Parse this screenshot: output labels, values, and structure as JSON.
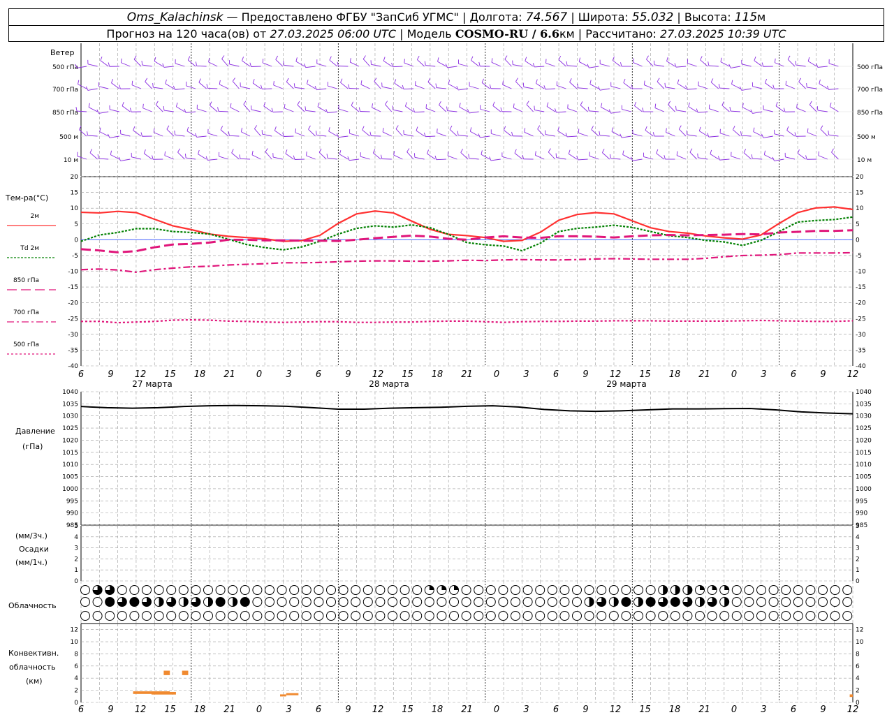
{
  "header": {
    "line1": {
      "station": "Oms_Kalachinsk",
      "provider": " — Предоставлено ФГБУ \"ЗапСиб УГМС\" | Долгота: ",
      "lon": "74.567",
      "lat_label": " | Широта: ",
      "lat": "55.032",
      "alt_label": " | Высота: ",
      "alt": "115",
      "alt_unit": "м"
    },
    "line2": {
      "forecast_label": "Прогноз на 120 часа(ов) от ",
      "forecast_start": "27.03.2025 06:00 UTC",
      "model_label": " | Модель ",
      "model": "COSMO-RU / 6.6",
      "model_unit": "км",
      "calc_label": " | Рассчитано: ",
      "calc_time": "27.03.2025 10:39 UTC"
    }
  },
  "panels": {
    "wind": {
      "title": "Ветер",
      "levels": [
        "500 гПа",
        "700 гПа",
        "850 гПа",
        "500 м",
        "10  м"
      ]
    },
    "temp": {
      "title": "Тем-ра(°C)",
      "legend": [
        {
          "label": "2м",
          "color": "#ff3030",
          "dash": ""
        },
        {
          "label": "Td  2м",
          "color": "#008000",
          "dash": "3,2"
        },
        {
          "label": "850 гПа",
          "color": "#e0157a",
          "dash": "14,6"
        },
        {
          "label": "700 гПа",
          "color": "#e0157a",
          "dash": "10,4,3,4"
        },
        {
          "label": "500 гПа",
          "color": "#e0157a",
          "dash": "3,3"
        }
      ]
    },
    "pressure": {
      "title": "Давление",
      "unit": "(гПа)"
    },
    "precip": {
      "unit_3h": "(мм/3ч.)",
      "title": "Осадки",
      "unit_1h": "(мм/1ч.)"
    },
    "clouds": {
      "title": "Облачность"
    },
    "convective": {
      "title": "Конвективн.",
      "title2": "облачность",
      "unit": "(км)"
    }
  },
  "time_axis": {
    "hour_labels": [
      "6",
      "9",
      "12",
      "15",
      "18",
      "21",
      "0",
      "3",
      "6",
      "9",
      "12",
      "15",
      "18",
      "21",
      "0",
      "3",
      "6",
      "9",
      "12",
      "15",
      "18",
      "21",
      "0",
      "3",
      "6",
      "9",
      "12"
    ],
    "days": [
      "27 марта",
      "28 марта",
      "29 марта"
    ]
  },
  "chart_data": [
    {
      "type": "line",
      "title": "Тем-ра(°C)",
      "x_step_hours": 3,
      "ylim": [
        -40,
        20
      ],
      "yticks": [
        20,
        15,
        10,
        5,
        0,
        -5,
        -10,
        -15,
        -20,
        -25,
        -30,
        -35,
        -40
      ],
      "series": [
        {
          "name": "2м",
          "color": "#ff3030",
          "values": [
            8.7,
            8.5,
            9.0,
            8.6,
            6.5,
            4.4,
            3.2,
            1.8,
            1.1,
            0.7,
            0.3,
            -0.5,
            -0.3,
            1.4,
            5.2,
            8.2,
            9.1,
            8.5,
            5.9,
            3.3,
            1.7,
            1.3,
            0.7,
            -0.5,
            -0.2,
            2.4,
            6.2,
            8.0,
            8.6,
            8.2,
            6.0,
            3.8,
            2.6,
            2.1,
            1.2,
            0.6,
            0.2,
            1.5,
            5.2,
            8.6,
            10.1,
            10.4,
            9.6
          ]
        },
        {
          "name": "Td  2м",
          "color": "#008000",
          "values": [
            -0.5,
            1.5,
            2.3,
            3.5,
            3.5,
            2.6,
            2.3,
            1.8,
            0.2,
            -1.5,
            -2.5,
            -3.2,
            -2.3,
            -0.5,
            1.8,
            3.6,
            4.4,
            4.0,
            4.7,
            3.8,
            1.7,
            -0.9,
            -1.6,
            -2.0,
            -3.5,
            -1.1,
            2.6,
            3.6,
            4.0,
            4.6,
            3.9,
            2.6,
            1.3,
            0.7,
            -0.2,
            -0.7,
            -1.8,
            -0.2,
            2.6,
            5.6,
            6.1,
            6.4,
            7.2
          ]
        },
        {
          "name": "850 гПа",
          "color": "#e0157a",
          "values": [
            -3.0,
            -3.4,
            -4.0,
            -3.6,
            -2.4,
            -1.5,
            -1.3,
            -0.9,
            0.0,
            0.0,
            -0.2,
            -0.2,
            -0.3,
            -0.3,
            -0.4,
            0.0,
            0.5,
            0.9,
            1.3,
            1.0,
            0.3,
            0.0,
            0.7,
            1.1,
            0.7,
            0.6,
            1.1,
            1.1,
            1.0,
            0.7,
            1.1,
            1.4,
            1.5,
            1.4,
            1.5,
            1.6,
            1.8,
            1.7,
            2.3,
            2.5,
            2.8,
            2.8,
            3.0
          ]
        },
        {
          "name": "700 гПа",
          "color": "#e0157a",
          "values": [
            -9.5,
            -9.3,
            -9.6,
            -10.3,
            -9.5,
            -9.0,
            -8.6,
            -8.4,
            -8.0,
            -7.8,
            -7.6,
            -7.3,
            -7.3,
            -7.2,
            -7.0,
            -6.8,
            -6.7,
            -6.7,
            -6.8,
            -6.8,
            -6.7,
            -6.5,
            -6.6,
            -6.4,
            -6.3,
            -6.4,
            -6.4,
            -6.3,
            -6.1,
            -6.0,
            -6.1,
            -6.2,
            -6.2,
            -6.2,
            -5.9,
            -5.4,
            -5.0,
            -4.9,
            -4.7,
            -4.2,
            -4.2,
            -4.2,
            -4.1
          ]
        },
        {
          "name": "500 гПа",
          "color": "#e0157a",
          "values": [
            -25.9,
            -25.9,
            -26.3,
            -26.1,
            -25.9,
            -25.5,
            -25.4,
            -25.5,
            -25.8,
            -25.9,
            -26.1,
            -26.2,
            -26.1,
            -26.0,
            -26.0,
            -26.2,
            -26.2,
            -26.1,
            -26.1,
            -25.9,
            -25.8,
            -25.8,
            -26.0,
            -26.2,
            -26.0,
            -25.9,
            -25.9,
            -25.8,
            -25.8,
            -25.7,
            -25.7,
            -25.7,
            -25.8,
            -25.8,
            -25.8,
            -25.8,
            -25.7,
            -25.6,
            -25.7,
            -25.8,
            -25.9,
            -25.9,
            -25.7
          ]
        }
      ]
    },
    {
      "type": "line",
      "title": "Давление",
      "ylabel": "(гПа)",
      "ylim": [
        985,
        1040
      ],
      "yticks": [
        1040,
        1035,
        1030,
        1025,
        1020,
        1015,
        1010,
        1005,
        1000,
        995,
        990,
        985
      ],
      "series": [
        {
          "name": "",
          "color": "#000000",
          "values": [
            1033.9,
            1033.4,
            1033.2,
            1033.4,
            1033.9,
            1034.2,
            1034.3,
            1034.2,
            1034.0,
            1033.4,
            1032.8,
            1032.8,
            1033.2,
            1033.4,
            1033.6,
            1034.0,
            1034.2,
            1033.7,
            1032.7,
            1032.1,
            1031.9,
            1032.1,
            1032.5,
            1032.9,
            1032.9,
            1033.0,
            1033.1,
            1032.5,
            1031.7,
            1031.2,
            1030.9
          ]
        }
      ]
    },
    {
      "type": "bar",
      "title": "Осадки",
      "ylabel": "(мм/3ч.) (мм/1ч.)",
      "ylim": [
        0,
        5
      ],
      "yticks": [
        5,
        4,
        3,
        2,
        1,
        0
      ],
      "values": []
    },
    {
      "type": "bar",
      "title": "Конвективн. облачность",
      "ylabel": "(км)",
      "ylim": [
        0,
        13
      ],
      "yticks": [
        12,
        10,
        8,
        6,
        4,
        2,
        0
      ],
      "bars": [
        {
          "h0": 8.5,
          "h1": 14.5,
          "base": 1.4,
          "top": 1.6
        },
        {
          "h0": 11.5,
          "h1": 15.5,
          "base": 1.3,
          "top": 1.5
        },
        {
          "h0": 13.5,
          "h1": 14.5,
          "base": 4.5,
          "top": 5.0
        },
        {
          "h0": 16.5,
          "h1": 17.5,
          "base": 4.5,
          "top": 5.0
        },
        {
          "h0": 32.5,
          "h1": 33.5,
          "base": 1.0,
          "top": 1.1
        },
        {
          "h0": 33.5,
          "h1": 35.5,
          "base": 1.2,
          "top": 1.3
        },
        {
          "h0": 125.5,
          "h1": 126.0,
          "base": 0.9,
          "top": 1.1
        }
      ]
    }
  ]
}
